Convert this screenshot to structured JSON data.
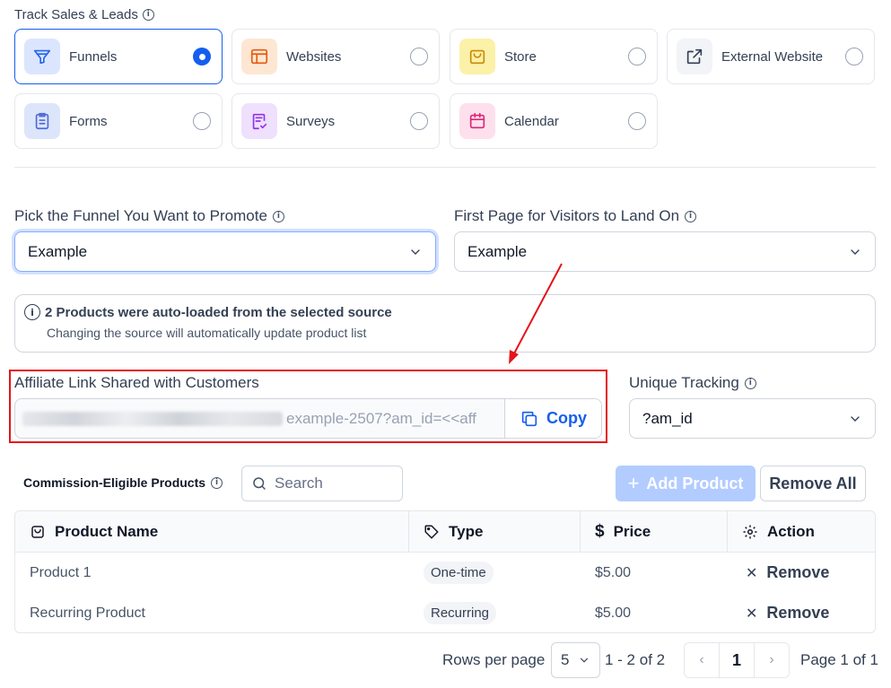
{
  "track_section": {
    "title": "Track Sales & Leads",
    "sources": [
      {
        "label": "Funnels",
        "icon": "funnel-icon",
        "selected": true
      },
      {
        "label": "Websites",
        "icon": "website-layout-icon",
        "selected": false
      },
      {
        "label": "Store",
        "icon": "shopping-bag-icon",
        "selected": false
      },
      {
        "label": "External Website",
        "icon": "external-link-icon",
        "selected": false
      },
      {
        "label": "Forms",
        "icon": "clipboard-icon",
        "selected": false
      },
      {
        "label": "Surveys",
        "icon": "survey-icon",
        "selected": false
      },
      {
        "label": "Calendar",
        "icon": "calendar-icon",
        "selected": false
      }
    ]
  },
  "funnel_select": {
    "label": "Pick the Funnel You Want to Promote",
    "value": "Example"
  },
  "landing_select": {
    "label": "First Page for Visitors to Land On",
    "value": "Example"
  },
  "notice": {
    "title": "2 Products were auto-loaded from the selected source",
    "subtitle": "Changing the source will automatically update product list"
  },
  "affiliate_link": {
    "label": "Affiliate Link Shared with Customers",
    "value": "example-2507?am_id=<<aff",
    "copy_label": "Copy"
  },
  "unique_tracking": {
    "label": "Unique Tracking",
    "value": "?am_id"
  },
  "products": {
    "title": "Commission-Eligible Products",
    "search_placeholder": "Search",
    "add_label": "Add Product",
    "remove_all_label": "Remove All",
    "columns": [
      "Product Name",
      "Type",
      "Price",
      "Action"
    ],
    "rows": [
      {
        "name": "Product 1",
        "type": "One-time",
        "price": "$5.00",
        "action": "Remove"
      },
      {
        "name": "Recurring Product",
        "type": "Recurring",
        "price": "$5.00",
        "action": "Remove"
      }
    ]
  },
  "pagination": {
    "rows_label": "Rows per page",
    "rows_value": "5",
    "range": "1 - 2 of 2",
    "current_page": "1",
    "page_of": "Page 1 of 1"
  },
  "colors": {
    "accent": "#155eef",
    "highlight": "#e5141b"
  }
}
